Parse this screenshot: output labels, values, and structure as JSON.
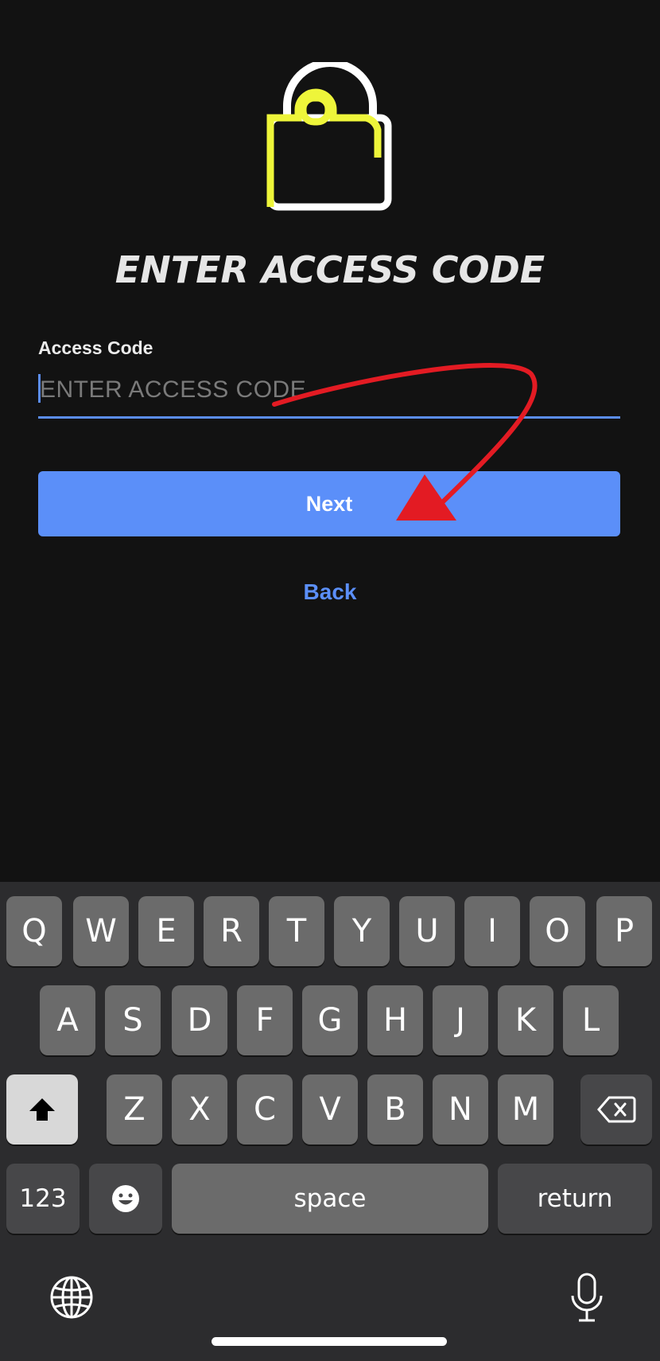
{
  "header": {
    "title": "ENTER ACCESS CODE"
  },
  "form": {
    "label": "Access Code",
    "placeholder": "ENTER ACCESS CODE",
    "next_label": "Next",
    "back_label": "Back"
  },
  "colors": {
    "background": "#121212",
    "accent": "#5b8ff9",
    "lock_yellow": "#eef53a",
    "annotation_red": "#e31b23"
  },
  "keyboard": {
    "row1": [
      "Q",
      "W",
      "E",
      "R",
      "T",
      "Y",
      "U",
      "I",
      "O",
      "P"
    ],
    "row2": [
      "A",
      "S",
      "D",
      "F",
      "G",
      "H",
      "J",
      "K",
      "L"
    ],
    "row3": [
      "Z",
      "X",
      "C",
      "V",
      "B",
      "N",
      "M"
    ],
    "numbers_label": "123",
    "space_label": "space",
    "return_label": "return",
    "icons": [
      "shift-icon",
      "delete-icon",
      "emoji-icon",
      "globe-icon",
      "microphone-icon"
    ]
  }
}
